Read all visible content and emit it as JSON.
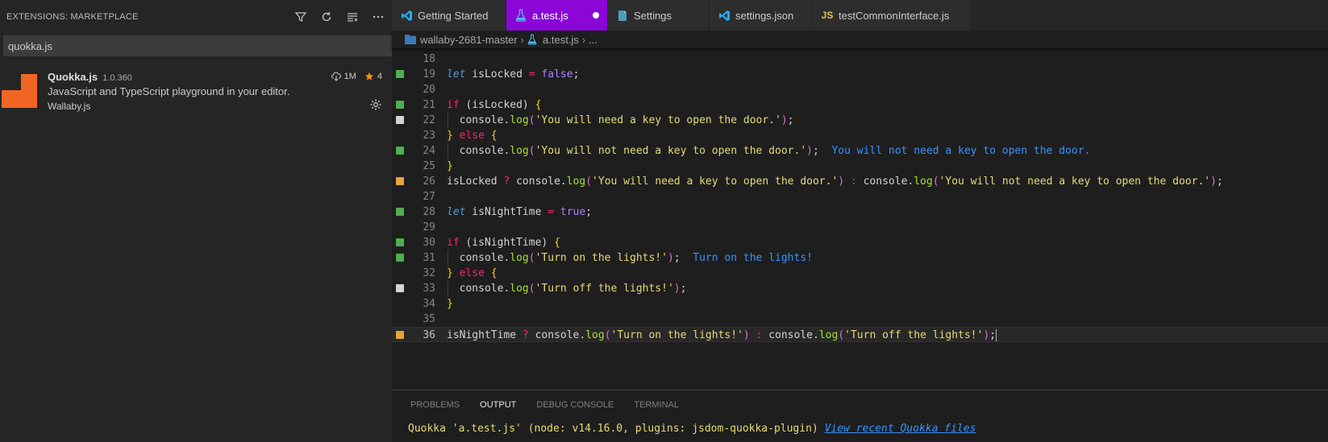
{
  "sidebar": {
    "title": "EXTENSIONS: MARKETPLACE",
    "search_value": "quokka.js",
    "extension": {
      "name": "Quokka.js",
      "version": "1.0.360",
      "description": "JavaScript and TypeScript playground in your editor.",
      "publisher": "Wallaby.js",
      "downloads": "1M",
      "rating": "4"
    }
  },
  "tabs": [
    {
      "label": "Getting Started"
    },
    {
      "label": "a.test.js"
    },
    {
      "label": "Settings"
    },
    {
      "label": "settings.json"
    },
    {
      "label": "testCommonInterface.js"
    }
  ],
  "breadcrumb": {
    "folder": "wallaby-2681-master",
    "file": "a.test.js",
    "more": "..."
  },
  "code": {
    "line_numbers": [
      "18",
      "19",
      "20",
      "21",
      "22",
      "23",
      "24",
      "25",
      "26",
      "27",
      "28",
      "29",
      "30",
      "31",
      "32",
      "33",
      "34",
      "35",
      "36"
    ],
    "inline_out_24": "You will not need a key to open the door.",
    "inline_out_31": "Turn on the lights!"
  },
  "panel": {
    "tabs": [
      "PROBLEMS",
      "OUTPUT",
      "DEBUG CONSOLE",
      "TERMINAL"
    ],
    "output_text": "Quokka 'a.test.js' (node: v14.16.0, plugins: jsdom-quokka-plugin) ",
    "output_link": "View recent Quokka files"
  },
  "colors": {
    "active_tab": "#8a07d8",
    "marker_green": "#4caf50",
    "marker_white": "#d4d4d4",
    "marker_orange": "#e6a23c",
    "quokka_orange": "#f26522"
  }
}
